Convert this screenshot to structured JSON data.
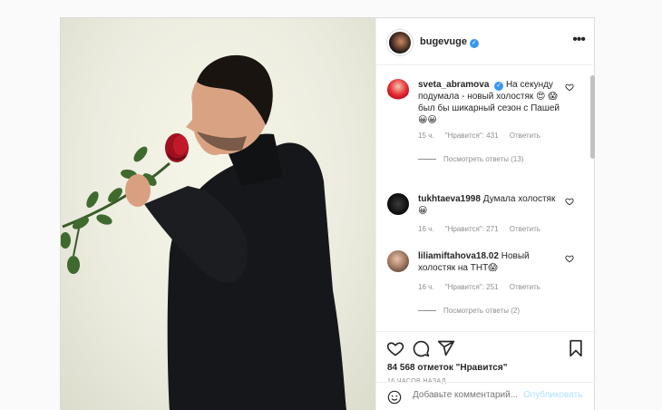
{
  "post": {
    "username": "bugevuge",
    "verified_mark": "✓"
  },
  "comments": [
    {
      "user": "sveta_abramova",
      "text": "На секунду подумала - новый холостяк 😍 😱 был бы шикарный сезон с Пашей 😀😀",
      "time": "15 ч.",
      "likes": "\"Нравится\": 431",
      "reply": "Ответить",
      "view_replies": "Посмотреть ответы (13)"
    },
    {
      "user": "tukhtaeva1998",
      "text": "Думала холостяк 😀",
      "time": "16 ч.",
      "likes": "\"Нравится\": 271",
      "reply": "Ответить"
    },
    {
      "user": "liliamiftahova18.02",
      "text": "Новый холостяк на ТНТ😱",
      "time": "16 ч.",
      "likes": "\"Нравится\": 251",
      "reply": "Ответить",
      "view_replies": "Посмотреть ответы (2)"
    }
  ],
  "actions": {
    "likes_text": "84 568 отметок \"Нравится\"",
    "posted_time": "16 часов назад"
  },
  "add_comment": {
    "placeholder": "Добавьте комментарий...",
    "publish_label": "Опубликовать"
  },
  "icons": [
    "more-icon",
    "heart-icon",
    "comment-icon",
    "share-icon",
    "bookmark-icon",
    "smile-icon"
  ]
}
